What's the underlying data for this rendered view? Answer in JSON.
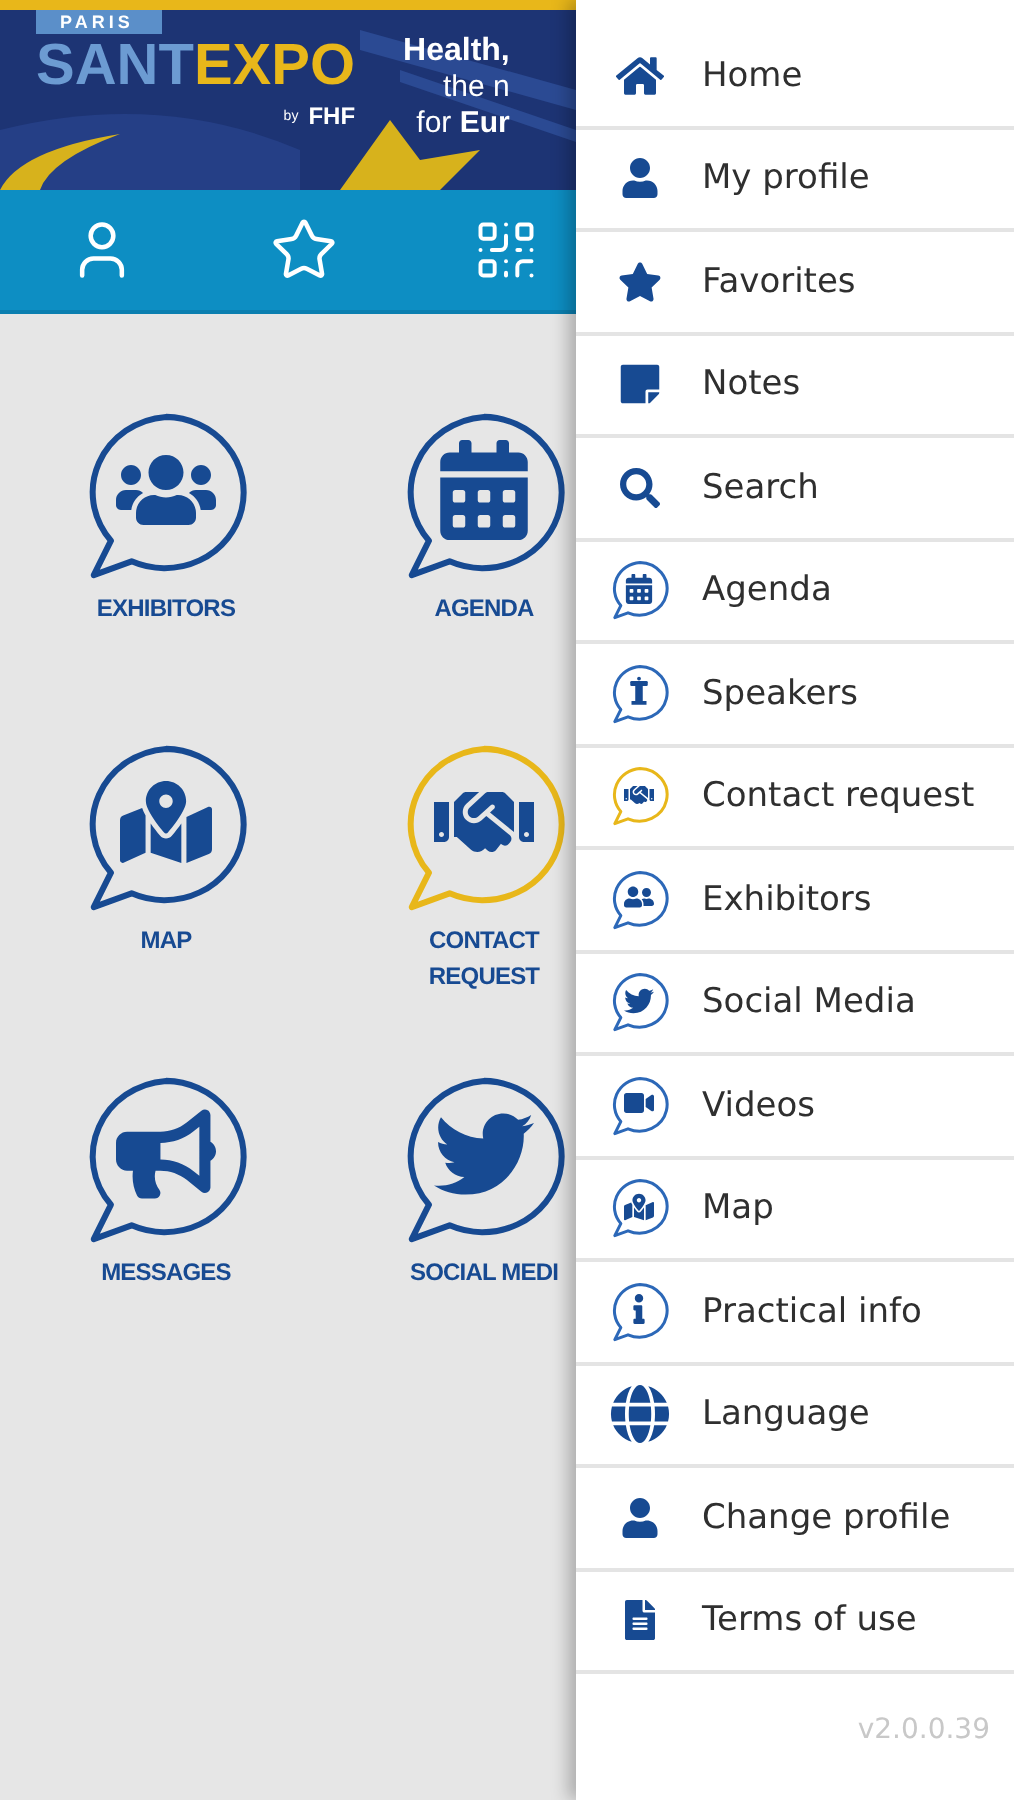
{
  "banner": {
    "city": "PARIS",
    "logo": "SANTEXPO",
    "by": "by",
    "partner": "FHF",
    "headline": [
      "Health,",
      "the n",
      "for **Eur**"
    ]
  },
  "toolbar": {
    "buttons": [
      {
        "kind": "profile"
      },
      {
        "kind": "favorites"
      },
      {
        "kind": "qr"
      }
    ]
  },
  "tiles": [
    {
      "label": "EXHIBITORS",
      "highlighted": false
    },
    {
      "label": "AGENDA",
      "highlighted": false
    },
    {
      "label": "MAP",
      "highlighted": false
    },
    {
      "label": "CONTACT REQUEST",
      "highlighted": true
    },
    {
      "label": "MESSAGES",
      "highlighted": false
    },
    {
      "label": "SOCIAL MEDI",
      "highlighted": false
    }
  ],
  "menu": {
    "items": [
      {
        "label": "Home",
        "kind": "plain",
        "highlighted": false
      },
      {
        "label": "My profile",
        "kind": "plain",
        "highlighted": false
      },
      {
        "label": "Favorites",
        "kind": "plain",
        "highlighted": false
      },
      {
        "label": "Notes",
        "kind": "plain",
        "highlighted": false
      },
      {
        "label": "Search",
        "kind": "plain",
        "highlighted": false
      },
      {
        "label": "Agenda",
        "kind": "bubble",
        "highlighted": false
      },
      {
        "label": "Speakers",
        "kind": "bubble",
        "highlighted": false
      },
      {
        "label": "Contact request",
        "kind": "bubble",
        "highlighted": true
      },
      {
        "label": "Exhibitors",
        "kind": "bubble",
        "highlighted": false
      },
      {
        "label": "Social Media",
        "kind": "bubble",
        "highlighted": false
      },
      {
        "label": "Videos",
        "kind": "bubble",
        "highlighted": false
      },
      {
        "label": "Map",
        "kind": "bubble",
        "highlighted": false
      },
      {
        "label": "Practical info",
        "kind": "bubble",
        "highlighted": false
      },
      {
        "label": "Language",
        "kind": "plain",
        "highlighted": false
      },
      {
        "label": "Change profile",
        "kind": "plain",
        "highlighted": false
      },
      {
        "label": "Terms of use",
        "kind": "plain",
        "highlighted": false
      }
    ],
    "version": "v2.0.0.39"
  }
}
